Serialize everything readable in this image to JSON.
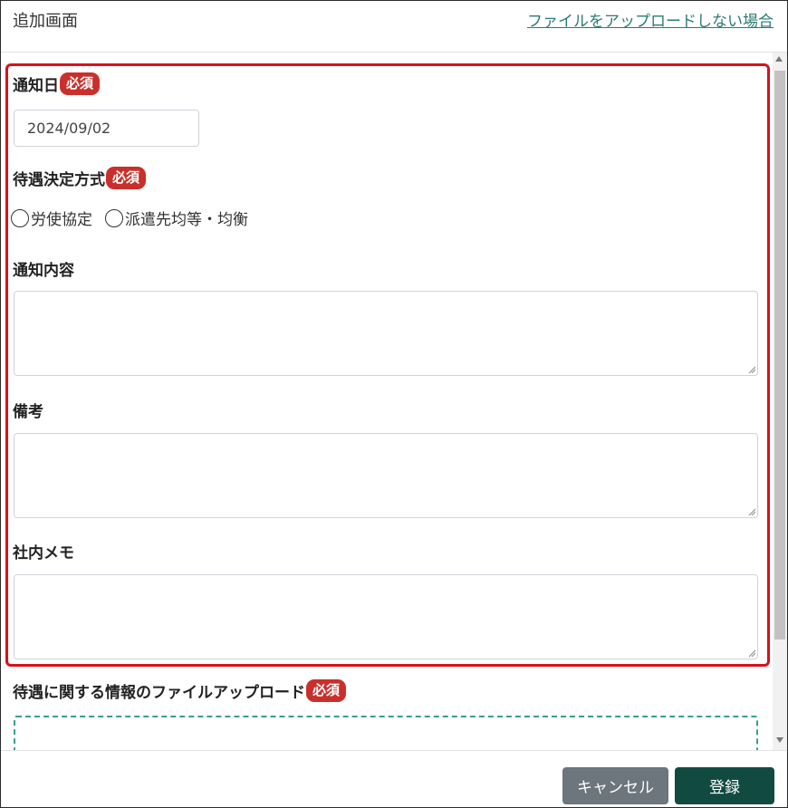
{
  "header": {
    "title": "追加画面",
    "skip_upload_link": "ファイルをアップロードしない場合"
  },
  "form": {
    "required_badge": "必須",
    "notice_date": {
      "label": "通知日",
      "value": "2024/09/02",
      "icon": "calendar-icon"
    },
    "treatment_method": {
      "label": "待遇決定方式",
      "options": [
        "労使協定",
        "派遣先均等・均衡"
      ]
    },
    "notice_content": {
      "label": "通知内容",
      "value": ""
    },
    "remarks": {
      "label": "備考",
      "value": ""
    },
    "internal_memo": {
      "label": "社内メモ",
      "value": ""
    },
    "file_upload": {
      "label": "待遇に関する情報のファイルアップロード"
    }
  },
  "footer": {
    "cancel_label": "キャンセル",
    "submit_label": "登録"
  },
  "colors": {
    "accent": "#2a7b74",
    "required_badge": "#c9302c",
    "highlight_border": "#d6121b",
    "submit_button": "#114a41",
    "cancel_button": "#6d757d"
  }
}
